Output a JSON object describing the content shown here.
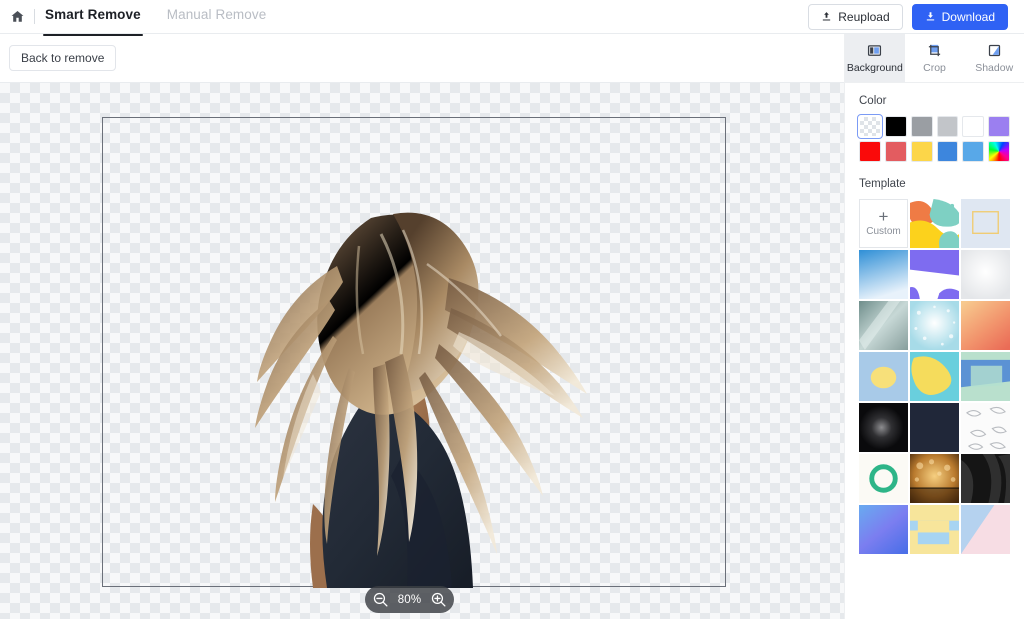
{
  "app": {
    "home_icon": "home-icon",
    "tabs": [
      {
        "label": "Smart Remove",
        "active": true
      },
      {
        "label": "Manual Remove",
        "active": false
      }
    ],
    "actions": {
      "reupload_label": "Reupload",
      "reupload_icon": "upload-icon",
      "download_label": "Download",
      "download_icon": "download-icon",
      "primary_color": "#2f62f4"
    }
  },
  "subbar": {
    "back_label": "Back to remove"
  },
  "canvas": {
    "background": "transparent-checkerboard",
    "zoom": {
      "value": "80%",
      "zoom_out_icon": "zoom-out-icon",
      "zoom_in_icon": "zoom-in-icon"
    },
    "image_alt": "woman-with-flowing-blonde-hair-cutout"
  },
  "panel": {
    "tabs": [
      {
        "label": "Background",
        "icon": "background-icon",
        "active": true
      },
      {
        "label": "Crop",
        "icon": "crop-icon",
        "active": false
      },
      {
        "label": "Shadow",
        "icon": "shadow-icon",
        "active": false
      }
    ],
    "color": {
      "title": "Color",
      "swatches": [
        {
          "name": "transparent",
          "hex": "transparent",
          "selected": true
        },
        {
          "name": "black",
          "hex": "#000000",
          "selected": false
        },
        {
          "name": "gray",
          "hex": "#9a9ea3",
          "selected": false
        },
        {
          "name": "light-gray",
          "hex": "#c2c5c9",
          "selected": false
        },
        {
          "name": "white",
          "hex": "#ffffff",
          "selected": false
        },
        {
          "name": "purple",
          "hex": "#9b7ff0",
          "selected": false
        },
        {
          "name": "red",
          "hex": "#fa0a0a",
          "selected": false
        },
        {
          "name": "coral",
          "hex": "#e35c60",
          "selected": false
        },
        {
          "name": "yellow",
          "hex": "#fcd649",
          "selected": false
        },
        {
          "name": "blue",
          "hex": "#3d86dd",
          "selected": false
        },
        {
          "name": "light-blue",
          "hex": "#58a8e8",
          "selected": false
        },
        {
          "name": "rainbow",
          "hex": "conic-rainbow",
          "selected": false
        }
      ]
    },
    "template": {
      "title": "Template",
      "custom": {
        "label": "Custom",
        "icon": "plus-icon"
      },
      "items": [
        {
          "name": "abstract-shapes-orange-yellow-teal"
        },
        {
          "name": "pale-blue-frame"
        },
        {
          "name": "blue-gradient"
        },
        {
          "name": "purple-white-geometric"
        },
        {
          "name": "white-soft-glow"
        },
        {
          "name": "grey-green-light-streak"
        },
        {
          "name": "icy-sparkle-blue"
        },
        {
          "name": "orange-peach-gradient"
        },
        {
          "name": "yellow-circle-on-blue"
        },
        {
          "name": "yellow-shape-on-teal"
        },
        {
          "name": "blue-green-rectangles"
        },
        {
          "name": "dark-glow-black"
        },
        {
          "name": "navy-texture"
        },
        {
          "name": "white-feathers"
        },
        {
          "name": "green-ring-on-cream"
        },
        {
          "name": "gold-bokeh-stage"
        },
        {
          "name": "black-silk-fabric"
        },
        {
          "name": "blue-violet-gradient"
        },
        {
          "name": "yellow-blue-blocks"
        },
        {
          "name": "blue-pink-diagonal"
        }
      ]
    }
  }
}
